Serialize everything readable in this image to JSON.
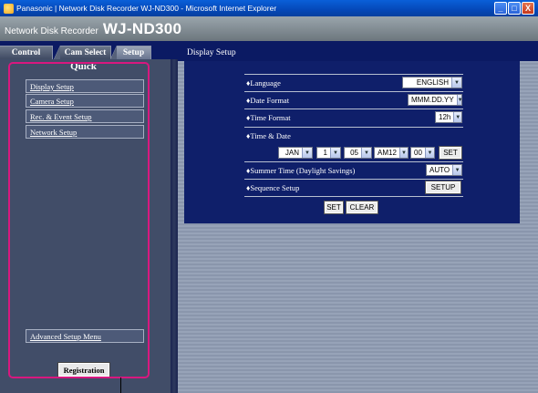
{
  "window": {
    "title": "Panasonic | Network Disk Recorder WJ-ND300 - Microsoft Internet Explorer",
    "controls": [
      "_",
      "□",
      "X"
    ]
  },
  "brand": {
    "small": "Network Disk Recorder",
    "big": "WJ-ND300"
  },
  "tabs": [
    "Control",
    "Cam Select",
    "Setup"
  ],
  "sidebar": {
    "heading": "Quick",
    "items": [
      "Display Setup",
      "Camera Setup",
      "Rec. & Event Setup",
      "Network Setup"
    ],
    "advanced": "Advanced Setup Menu",
    "registration": "Registration"
  },
  "main": {
    "title": "Display Setup",
    "rows": [
      {
        "label": "♦Language",
        "value": "ENGLISH"
      },
      {
        "label": "♦Date Format",
        "value": "MMM.DD.YY"
      },
      {
        "label": "♦Time Format",
        "value": "12h"
      },
      {
        "label": "♦Time & Date"
      },
      {
        "label": "♦Summer Time (Daylight Savings)",
        "value": "AUTO"
      },
      {
        "label": "♦Sequence Setup",
        "button": "SETUP"
      }
    ],
    "datetime": {
      "month": "JAN",
      "day": "1",
      "year": "05",
      "hour": "AM12",
      "minute": "00",
      "set": "SET"
    },
    "actions": {
      "set": "SET",
      "clear": "CLEAR"
    }
  }
}
